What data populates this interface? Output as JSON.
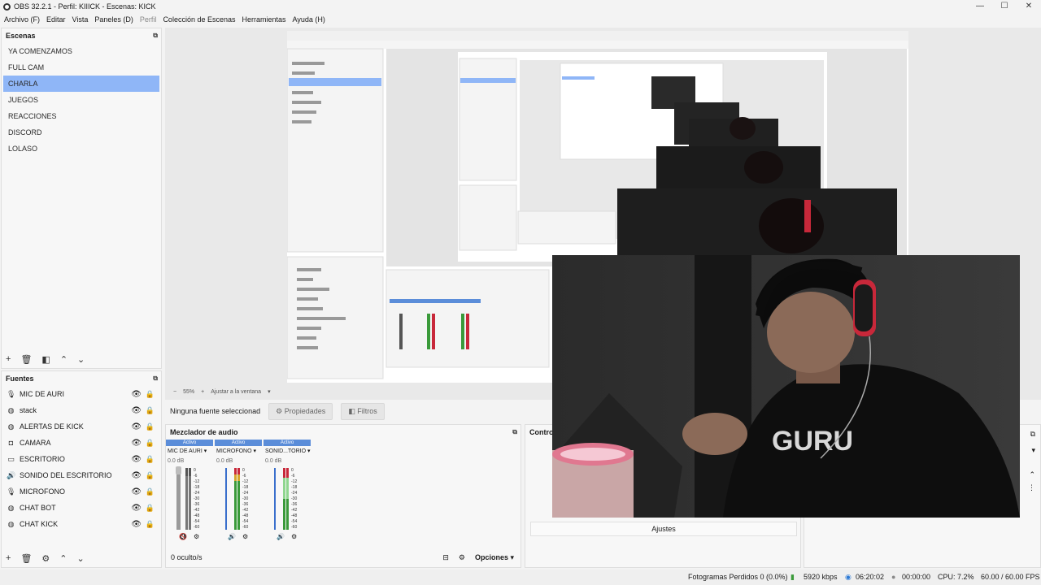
{
  "window": {
    "title": "OBS 32.2.1 - Perfil: KIIICK - Escenas: KICK"
  },
  "menu": {
    "archivo": "Archivo (F)",
    "editar": "Editar",
    "vista": "Vista",
    "paneles": "Paneles (D)",
    "perfil": "Perfil",
    "coleccion": "Colección de Escenas",
    "herramientas": "Herramientas",
    "ayuda": "Ayuda (H)"
  },
  "scenes": {
    "title": "Escenas",
    "items": [
      "YA COMENZAMOS",
      "FULL CAM",
      "CHARLA",
      "JUEGOS",
      "REACCIONES",
      "DISCORD",
      "LOLASO"
    ],
    "active_index": 2
  },
  "sources": {
    "title": "Fuentes",
    "items": [
      {
        "label": "MIC DE AURI",
        "icon": "microphone-icon"
      },
      {
        "label": "stack",
        "icon": "globe-icon"
      },
      {
        "label": "ALERTAS DE KICK",
        "icon": "globe-icon"
      },
      {
        "label": "CAMARA",
        "icon": "camera-icon"
      },
      {
        "label": "ESCRITORIO",
        "icon": "monitor-icon"
      },
      {
        "label": "SONIDO DEL ESCRITORIO",
        "icon": "speaker-icon"
      },
      {
        "label": "MICROFONO",
        "icon": "microphone-icon"
      },
      {
        "label": "CHAT BOT",
        "icon": "globe-icon"
      },
      {
        "label": "CHAT KICK",
        "icon": "globe-icon"
      }
    ]
  },
  "preview": {
    "zoom": "55%",
    "fit": "Ajustar a la ventana"
  },
  "source_bar": {
    "no_source": "Ninguna fuente seleccionad",
    "properties": "Propiedades",
    "filters": "Filtros"
  },
  "mixer": {
    "title": "Mezclador de audio",
    "active_label": "Activo",
    "channels": [
      {
        "name": "MIC DE AURI",
        "db": "0.0 dB",
        "muted": true
      },
      {
        "name": "MICROFONO",
        "db": "0.0 dB",
        "muted": false
      },
      {
        "name": "SONID...TORIO",
        "db": "0.0 dB",
        "muted": false
      }
    ],
    "scale": [
      "0",
      "-6",
      "-12",
      "-18",
      "-24",
      "-30",
      "-36",
      "-42",
      "-48",
      "-54",
      "-60"
    ],
    "hidden": "0 oculto/s",
    "options": "Opciones"
  },
  "controls": {
    "title": "Contro",
    "settings": "Ajustes"
  },
  "status": {
    "dropped": "Fotogramas Perdidos 0 (0.0%)",
    "bitrate": "5920 kbps",
    "stream_time": "06:20:02",
    "rec_time": "00:00:00",
    "cpu": "CPU: 7.2%",
    "fps": "60.00 / 60.00 FPS"
  },
  "colors": {
    "accent": "#8fb6f7",
    "active_channel": "#5b8dd9",
    "stream_live": "#2e7bd6",
    "signal_green": "#3a9a3a",
    "headphone_red": "#c8283a"
  }
}
